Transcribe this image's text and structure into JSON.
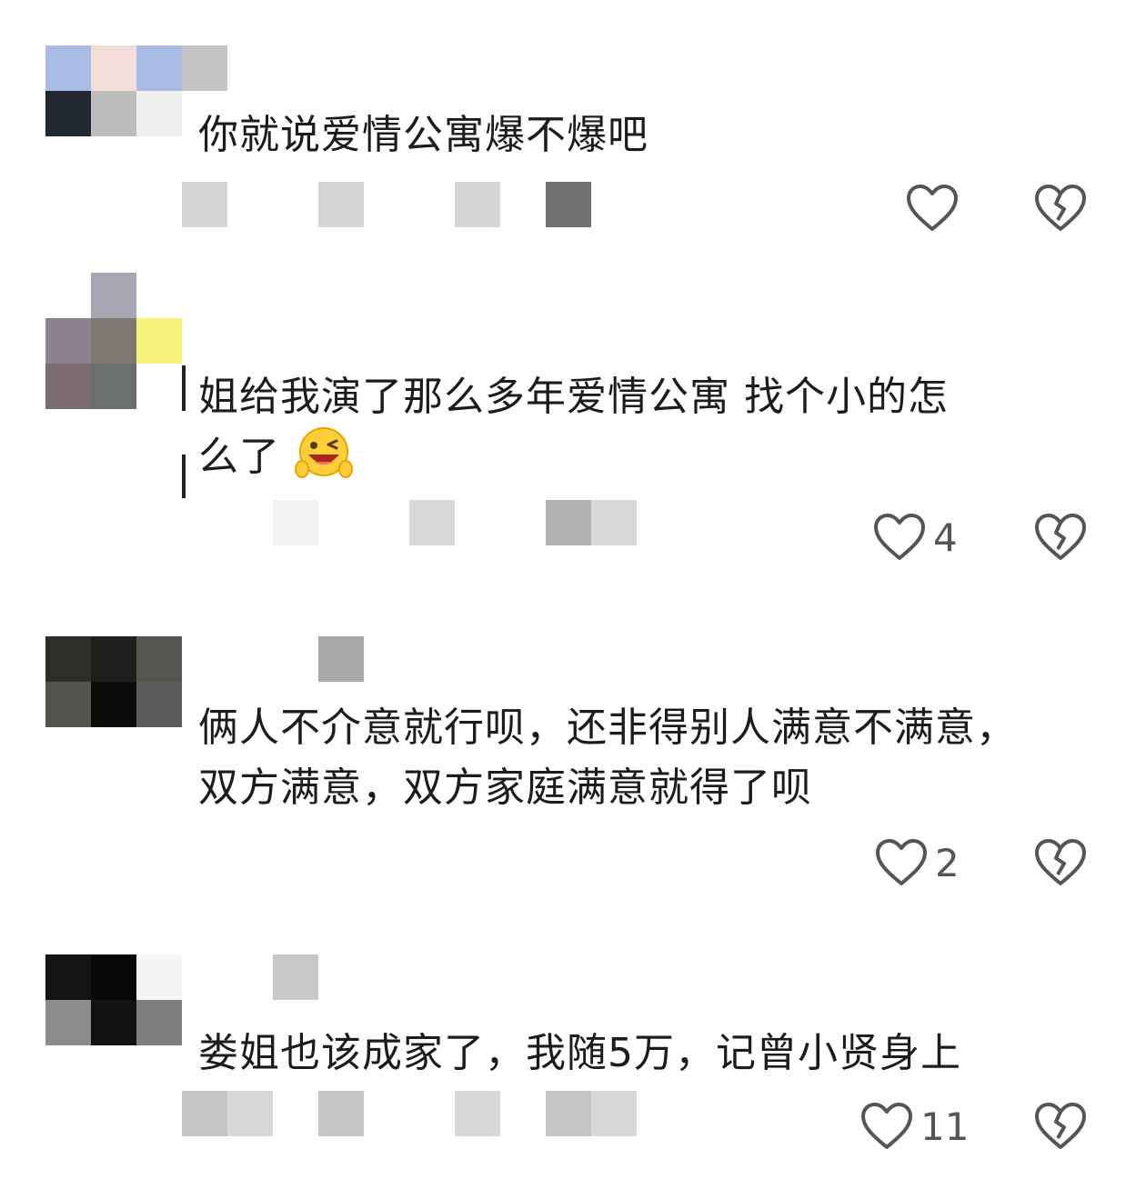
{
  "comments": [
    {
      "lines": [
        "你就说爱情公寓爆不爆吧"
      ],
      "like_count": "",
      "avatar_colors": [
        "#a8bce4",
        "#f2ddd8",
        "#a8bce4",
        "#c4c4c4",
        "#222831",
        "#bdbdbd",
        "#efefef",
        "#ffffff"
      ],
      "meta_colors": [
        "#d6d6d6",
        "#d6d6d6",
        "#d6d6d6",
        "#727272"
      ]
    },
    {
      "lines": [
        "姐给我演了那么多年爱情公寓 找个小的怎",
        "么了"
      ],
      "like_count": "4",
      "avatar_colors": [
        "#ffffff",
        "#a7a7b3",
        "#ffffff",
        "#8c8091",
        "#7c7a70",
        "#f8f47b",
        "#7a6b73",
        "#6c706c",
        "#ffffff"
      ],
      "meta_colors": [
        "#f3f3f3",
        "#f3f3f3",
        "#d9d9d9",
        "#b2b2b2",
        "#d9d9d9"
      ]
    },
    {
      "lines": [
        "俩人不介意就行呗，还非得别人满意不满意，",
        "双方满意，双方家庭满意就得了呗"
      ],
      "like_count": "2",
      "avatar_colors": [
        "#2e2e28",
        "#1e1e1c",
        "#555552",
        "#555550",
        "#0a0a08",
        "#5a5a5c"
      ],
      "meta_colors": [
        "#a8a8a8"
      ]
    },
    {
      "lines": [
        "娄姐也该成家了，我随5万，记曾小贤身上"
      ],
      "like_count": "11",
      "avatar_colors": [
        "#141414",
        "#070707",
        "#f4f4f4",
        "#8c8c8c",
        "#121212",
        "#7e7e7e"
      ],
      "meta_colors": [
        "#c6c6c6",
        "#d8d8d8",
        "#c6c6c6",
        "#d8d8d8",
        "#c6c6c6",
        "#d8d8d8"
      ],
      "top_extra_color": "#c8c8c8"
    }
  ],
  "icons": {
    "like": "heart-outline-icon",
    "dislike": "broken-heart-icon",
    "emoji": "wink-victory-emoji"
  }
}
